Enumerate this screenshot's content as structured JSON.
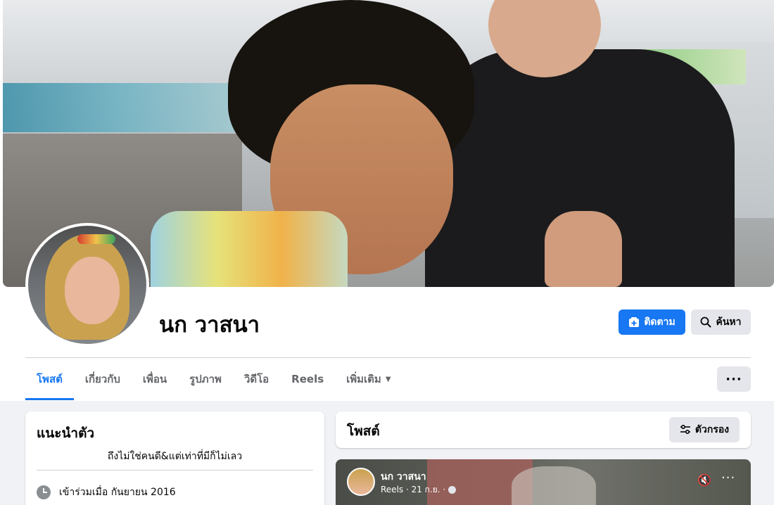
{
  "profile": {
    "name": "นก วาสนา",
    "follow_label": "ติดตาม",
    "search_label": "ค้นหา",
    "more_label": "···"
  },
  "tabs": [
    {
      "label": "โพสต์",
      "active": true
    },
    {
      "label": "เกี่ยวกับ"
    },
    {
      "label": "เพื่อน"
    },
    {
      "label": "รูปภาพ"
    },
    {
      "label": "วิดีโอ"
    },
    {
      "label": "Reels"
    },
    {
      "label": "เพิ่มเติม"
    }
  ],
  "intro": {
    "title": "แนะนำตัว",
    "bio": "ถึงไม่ใช่คนดี&แต่เท่าที่มีก็ไม่เลว",
    "joined": "เข้าร่วมเมื่อ กันยายน 2016"
  },
  "posts": {
    "title": "โพสต์",
    "filter_label": "ตัวกรอง",
    "first_post": {
      "author": "นก วาสนา",
      "meta": "Reels · 21 ก.ย. ·",
      "more_label": "···"
    }
  },
  "colors": {
    "accent": "#1877f2",
    "page_bg": "#f0f2f5",
    "secondary_button": "#e4e6eb"
  }
}
